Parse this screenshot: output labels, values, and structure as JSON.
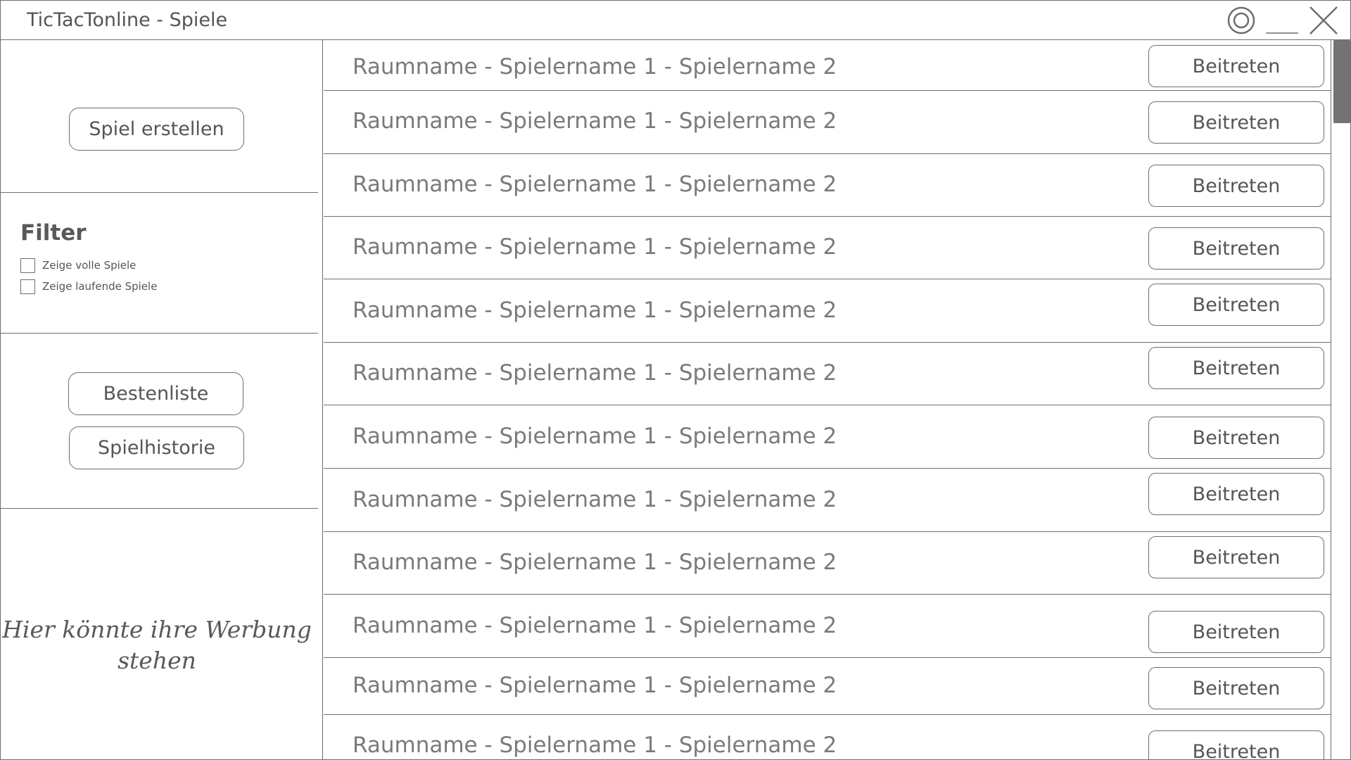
{
  "window": {
    "title": "TicTacTonline - Spiele"
  },
  "titlebar_icons": [
    "settings-icon",
    "minimize-icon",
    "close-icon"
  ],
  "sidebar": {
    "create_button": "Spiel erstellen",
    "filter": {
      "title": "Filter",
      "options": [
        {
          "label": "Zeige volle Spiele",
          "checked": false
        },
        {
          "label": "Zeige laufende Spiele",
          "checked": false
        }
      ]
    },
    "leaderboard_button": "Bestenliste",
    "history_button": "Spielhistorie",
    "ad_text": "Hier könnte ihre Werbung stehen"
  },
  "games": [
    {
      "label": "Raumname - Spielername 1 - Spielername 2",
      "action": "Beitreten"
    },
    {
      "label": "Raumname - Spielername 1 - Spielername 2",
      "action": "Beitreten"
    },
    {
      "label": "Raumname - Spielername 1 - Spielername 2",
      "action": "Beitreten"
    },
    {
      "label": "Raumname - Spielername 1 - Spielername 2",
      "action": "Beitreten"
    },
    {
      "label": "Raumname - Spielername 1 - Spielername 2",
      "action": "Beitreten"
    },
    {
      "label": "Raumname - Spielername 1 - Spielername 2",
      "action": "Beitreten"
    },
    {
      "label": "Raumname - Spielername 1 - Spielername 2",
      "action": "Beitreten"
    },
    {
      "label": "Raumname - Spielername 1 - Spielername 2",
      "action": "Beitreten"
    },
    {
      "label": "Raumname - Spielername 1 - Spielername 2",
      "action": "Beitreten"
    },
    {
      "label": "Raumname - Spielername 1 - Spielername 2",
      "action": "Beitreten"
    },
    {
      "label": "Raumname - Spielername 1 - Spielername 2",
      "action": "Beitreten"
    },
    {
      "label": "Raumname - Spielername 1 - Spielername 2",
      "action": "Beitreten"
    }
  ],
  "colors": {
    "line": "#6e6e6e",
    "text": "#595959",
    "scroll_thumb": "#737373"
  }
}
